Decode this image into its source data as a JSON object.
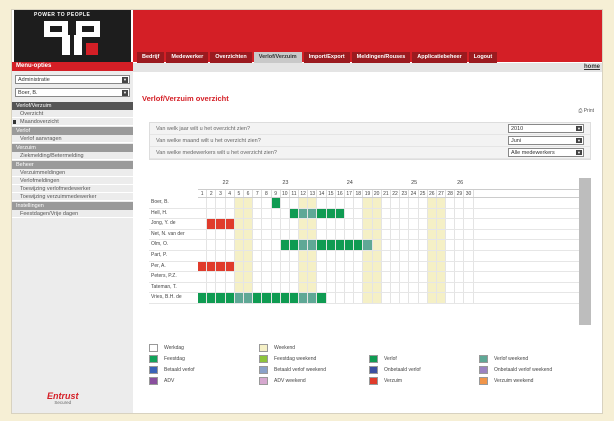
{
  "logo": {
    "tagline": "POWER TO PEOPLE",
    "brand": "HRM"
  },
  "tabs": [
    {
      "label": "Bedrijf",
      "active": false
    },
    {
      "label": "Medewerker",
      "active": false
    },
    {
      "label": "Overzichten",
      "active": false
    },
    {
      "label": "Verlof/Verzuim",
      "active": true
    },
    {
      "label": "Import/Export",
      "active": false
    },
    {
      "label": "Meldingen/Rouses",
      "active": false
    },
    {
      "label": "Applicatiebeheer",
      "active": false
    },
    {
      "label": "Logout",
      "active": false
    }
  ],
  "home_link": "home",
  "sidebar": {
    "title": "Menu-opties",
    "select1": "Administratie",
    "select2": "Boer, B.",
    "groups": [
      {
        "label": "Verlof/Verzuim",
        "dark": true,
        "items": [
          {
            "label": "Overzicht"
          },
          {
            "label": "Maandoverzicht",
            "marker": true
          }
        ]
      },
      {
        "label": "Verlof",
        "items": [
          {
            "label": "Verlof aanvragen"
          }
        ]
      },
      {
        "label": "Verzuim",
        "items": [
          {
            "label": "Ziekmelding/Betermelding"
          }
        ]
      },
      {
        "label": "Beheer",
        "items": [
          {
            "label": "Verzuimmeldingen"
          },
          {
            "label": "Verlofmeldingen"
          },
          {
            "label": "Toewijzing verlofmedewerker"
          },
          {
            "label": "Toewijzing verzuimmedewerker"
          }
        ]
      },
      {
        "label": "Instellingen",
        "items": [
          {
            "label": "Feestdagen/Vrije dagen"
          }
        ]
      }
    ],
    "footer_logo": "Entrust",
    "footer_sub": "Secured"
  },
  "main": {
    "title": "Verlof/Verzuim overzicht",
    "print_label": "Print",
    "questions": [
      {
        "q": "Van welk jaar wilt u het overzicht zien?",
        "value": "2010"
      },
      {
        "q": "Van welke maand wilt u het overzicht zien?",
        "value": "Juni"
      },
      {
        "q": "Van welke medewerkers wilt u het overzicht zien?",
        "value": "Alle medewerkers"
      }
    ]
  },
  "calendar": {
    "weeks": [
      {
        "label": "22",
        "start": 1,
        "end": 6
      },
      {
        "label": "23",
        "start": 7,
        "end": 13
      },
      {
        "label": "24",
        "start": 14,
        "end": 20
      },
      {
        "label": "25",
        "start": 21,
        "end": 27
      },
      {
        "label": "26",
        "start": 28,
        "end": 30
      }
    ],
    "days": 30,
    "weekend_days": [
      5,
      6,
      12,
      13,
      19,
      20,
      26,
      27
    ],
    "employees": [
      {
        "name": "Boer, B.",
        "marks": {
          "9": "verlof"
        }
      },
      {
        "name": "Hell, H.",
        "marks": {
          "11": "verlof",
          "12": "verlof-weekend",
          "13": "verlof-weekend",
          "14": "verlof",
          "15": "verlof",
          "16": "verlof"
        }
      },
      {
        "name": "Jong, Y. de",
        "marks": {
          "2": "verzuim",
          "3": "verzuim",
          "4": "verzuim"
        }
      },
      {
        "name": "Net, N. van der",
        "marks": {}
      },
      {
        "name": "Olm, O.",
        "marks": {
          "10": "verlof",
          "11": "verlof",
          "12": "verlof-weekend",
          "13": "verlof-weekend",
          "14": "verlof",
          "15": "verlof",
          "16": "verlof",
          "17": "verlof",
          "18": "verlof",
          "19": "verlof-weekend"
        }
      },
      {
        "name": "Part, P.",
        "marks": {}
      },
      {
        "name": "Per, A.",
        "marks": {
          "1": "verzuim",
          "2": "verzuim",
          "3": "verzuim",
          "4": "verzuim"
        }
      },
      {
        "name": "Peters, P.Z.",
        "marks": {}
      },
      {
        "name": "Tateman, T.",
        "marks": {}
      },
      {
        "name": "Vries, B.H. de",
        "marks": {
          "1": "verlof",
          "2": "verlof",
          "3": "verlof",
          "4": "verlof",
          "5": "verlof-weekend",
          "6": "verlof-weekend",
          "7": "verlof",
          "8": "verlof",
          "9": "verlof",
          "10": "verlof",
          "11": "verlof",
          "12": "verlof-weekend",
          "13": "verlof-weekend",
          "14": "verlof"
        }
      }
    ]
  },
  "legend": [
    [
      {
        "label": "Werkdag",
        "color": "#ffffff"
      },
      {
        "label": "Weekend",
        "color": "#f5f0c6"
      },
      null,
      null
    ],
    [
      {
        "label": "Feestdag",
        "color": "#12a35a"
      },
      {
        "label": "Feestdag weekend",
        "color": "#8dc43c"
      },
      {
        "label": "Verlof",
        "color": "#0f9b52"
      },
      {
        "label": "Verlof weekend",
        "color": "#5fa896"
      }
    ],
    [
      {
        "label": "Betaald verlof",
        "color": "#3a63b8"
      },
      {
        "label": "Betaald verlof weekend",
        "color": "#8aa1c9"
      },
      {
        "label": "Onbetaald verlof",
        "color": "#3b4fa0"
      },
      {
        "label": "Onbetaald verlof weekend",
        "color": "#9b83c2"
      }
    ],
    [
      {
        "label": "ADV",
        "color": "#8a4f9e"
      },
      {
        "label": "ADV weekend",
        "color": "#d6a8cf"
      },
      {
        "label": "Verzuim",
        "color": "#e03b2b"
      },
      {
        "label": "Verzuim weekend",
        "color": "#f0954a"
      }
    ]
  ],
  "colors": {
    "accent": "#d41f26",
    "weekend": "#f5f0c6",
    "verlof": "#0f9b52",
    "verlof-weekend": "#5fa896",
    "verzuim": "#e03b2b"
  }
}
